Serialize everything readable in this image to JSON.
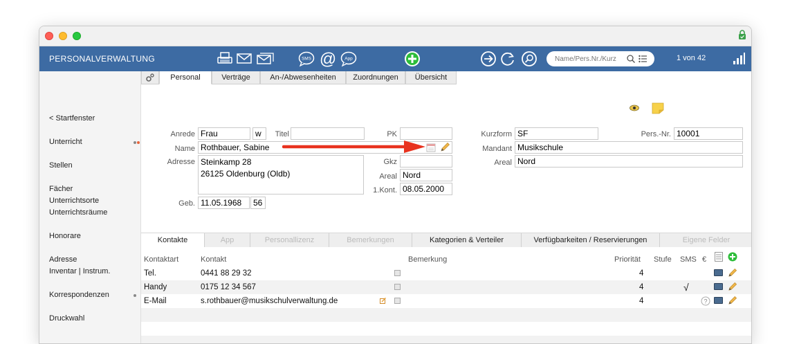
{
  "toolbar": {
    "title": "PERSONALVERWALTUNG",
    "search_placeholder": "Name/Pers.Nr./Kurz",
    "record_counter": "1 von 42",
    "sms_label": "SMS",
    "app_label": "App"
  },
  "sidebar": {
    "items": [
      {
        "label": "< Startfenster"
      },
      {
        "label": "Unterricht"
      },
      {
        "label": "Stellen"
      },
      {
        "label": "Fächer"
      },
      {
        "label": "Unterrichtsorte"
      },
      {
        "label": "Unterrichtsräume"
      },
      {
        "label": "Honorare"
      },
      {
        "label": "Adresse"
      },
      {
        "label": "Inventar | Instrum."
      },
      {
        "label": "Korrespondenzen"
      },
      {
        "label": "Druckwahl"
      }
    ]
  },
  "tabs_top": [
    "Personal",
    "Verträge",
    "An-/Abwesenheiten",
    "Zuordnungen",
    "Übersicht"
  ],
  "form": {
    "anrede_label": "Anrede",
    "anrede": "Frau",
    "geschlecht": "w",
    "titel_label": "Titel",
    "titel": "",
    "pk_label": "PK",
    "pk": "",
    "name_label": "Name",
    "name": "Rothbauer, Sabine",
    "adresse_label": "Adresse",
    "adresse": "Steinkamp 28\n26125 Oldenburg (Oldb)",
    "gkz_label": "Gkz",
    "gkz": "",
    "areal_label": "Areal",
    "areal": "Nord",
    "kont_label": "1.Kont.",
    "kont": "08.05.2000",
    "geb_label": "Geb.",
    "geb": "11.05.1968",
    "alter": "56",
    "kurzform_label": "Kurzform",
    "kurzform": "SF",
    "persnr_label": "Pers.-Nr.",
    "persnr": "10001",
    "mandant_label": "Mandant",
    "mandant": "Musikschule",
    "areal2_label": "Areal",
    "areal2": "Nord"
  },
  "tabs_bottom": [
    {
      "label": "Kontakte",
      "state": "active"
    },
    {
      "label": "App",
      "state": "disabled"
    },
    {
      "label": "Personallizenz",
      "state": "disabled"
    },
    {
      "label": "Bemerkungen",
      "state": "disabled"
    },
    {
      "label": "Kategorien & Verteiler",
      "state": "normal"
    },
    {
      "label": "Verfügbarkeiten / Reservierungen",
      "state": "normal"
    },
    {
      "label": "Eigene Felder",
      "state": "disabled"
    }
  ],
  "contacts": {
    "headers": {
      "kontaktart": "Kontaktart",
      "kontakt": "Kontakt",
      "bemerkung": "Bemerkung",
      "prioritaet": "Priorität",
      "stufe": "Stufe",
      "sms": "SMS",
      "euro": "€"
    },
    "rows": [
      {
        "art": "Tel.",
        "kontakt": "0441 88 29 32",
        "prioritaet": "4",
        "sms": ""
      },
      {
        "art": "Handy",
        "kontakt": "0175 12 34 567",
        "prioritaet": "4",
        "sms": "√"
      },
      {
        "art": "E-Mail",
        "kontakt": "s.rothbauer@musikschulverwaltung.de",
        "prioritaet": "4",
        "sms": ""
      }
    ]
  },
  "colors": {
    "toolbar_bg": "#3d6ba3",
    "annotation_arrow": "#e8321e",
    "add_green": "#2dbd3a"
  }
}
